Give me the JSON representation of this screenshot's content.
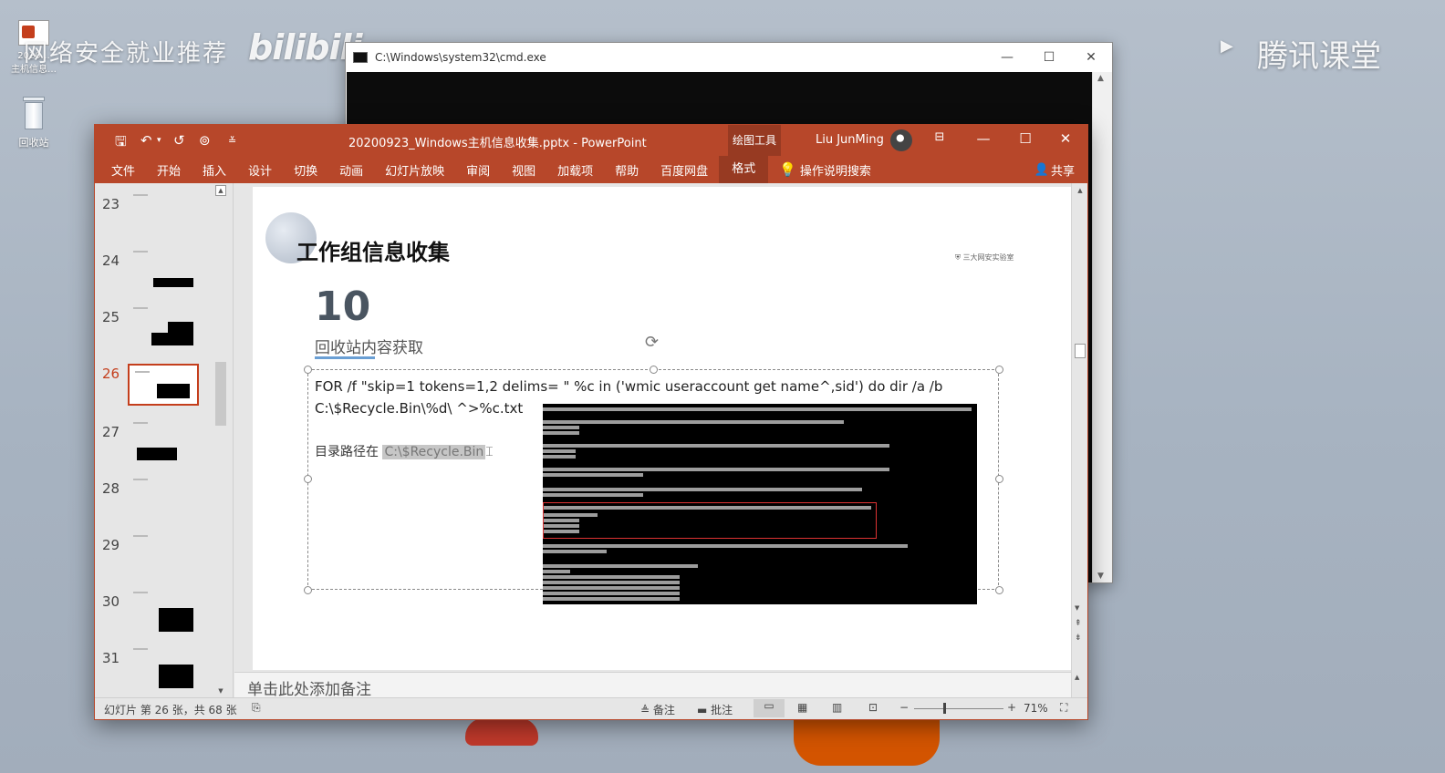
{
  "desktop": {
    "icons": [
      {
        "label": "2020…\n主机信息…",
        "icon": "pptx-file-icon"
      },
      {
        "label": "回收站",
        "icon": "recycle-bin-icon"
      }
    ],
    "watermark_left": "网络安全就业推荐",
    "watermark_logo": "bilibili",
    "watermark_right": "腾讯课堂"
  },
  "cmd": {
    "title": "C:\\Windows\\system32\\cmd.exe",
    "controls": [
      "—",
      "☐",
      "✕"
    ]
  },
  "ppt": {
    "title": "20200923_Windows主机信息收集.pptx  -  PowerPoint",
    "drawing_tools": "绘图工具",
    "user": "Liu JunMing",
    "controls": [
      "—",
      "☐",
      "✕"
    ],
    "tabs": [
      "文件",
      "开始",
      "插入",
      "设计",
      "切换",
      "动画",
      "幻灯片放映",
      "审阅",
      "视图",
      "加载项",
      "帮助",
      "百度网盘",
      "格式"
    ],
    "tell_me": "操作说明搜索",
    "share": "共享",
    "thumbnails": [
      {
        "num": "23"
      },
      {
        "num": "24"
      },
      {
        "num": "25"
      },
      {
        "num": "26"
      },
      {
        "num": "27"
      },
      {
        "num": "28"
      },
      {
        "num": "29"
      },
      {
        "num": "30"
      },
      {
        "num": "31"
      }
    ],
    "active_slide": "26",
    "slide": {
      "heading": "工作组信息收集",
      "number": "10",
      "subtitle": "回收站内容获取",
      "line1": "FOR /f \"skip=1 tokens=1,2 delims= \" %c in ('wmic useraccount get name^,sid') do dir /a /b",
      "line2": "C:\\$Recycle.Bin\\%d\\ ^>%c.txt",
      "path_label": "目录路径在 ",
      "path_value": "C:\\$Recycle.Bin",
      "logo_text": "三大网安实验室"
    },
    "notes_placeholder": "单击此处添加备注",
    "status": {
      "slide_info": "幻灯片 第 26 张，共 68 张",
      "notes_btn": "备注",
      "comments_btn": "批注",
      "zoom": "71%"
    }
  }
}
